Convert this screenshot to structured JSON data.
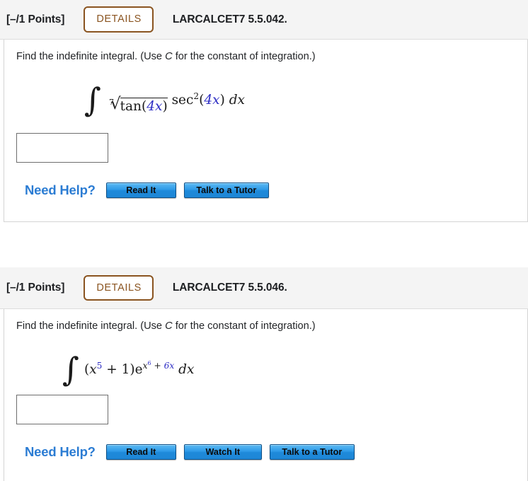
{
  "problems": [
    {
      "points_label": "[–/1 Points]",
      "details_label": "DETAILS",
      "assignment_id": "LARCALCET7 5.5.042.",
      "prompt_before": "Find the indefinite integral. (Use ",
      "prompt_var": "C",
      "prompt_after": " for the constant of integration.)",
      "math_plain": "∫ 7√(tan(4x)) sec^2(4x) dx",
      "math": {
        "integral_sign": "∫",
        "radical_index": "7",
        "radical_sign": "√",
        "fn1": "tan(",
        "arg1": "4x",
        "fn1_close": ")",
        "fn2": "sec",
        "fn2_exp": "2",
        "fn2_open": "(",
        "arg2": "4x",
        "fn2_close": ")",
        "differential": "dx"
      },
      "answer_value": "",
      "need_help_label": "Need Help?",
      "help_buttons": [
        "Read It",
        "Talk to a Tutor"
      ]
    },
    {
      "points_label": "[–/1 Points]",
      "details_label": "DETAILS",
      "assignment_id": "LARCALCET7 5.5.046.",
      "prompt_before": "Find the indefinite integral. (Use ",
      "prompt_var": "C",
      "prompt_after": " for the constant of integration.)",
      "math_plain": "∫ (x^5 + 1)e^(x^6 + 6x) dx",
      "math": {
        "integral_sign": "∫",
        "open_paren": "(",
        "base_var": "x",
        "base_exp": "5",
        "plus_one": " + 1)",
        "e_sym": "e",
        "exp_var": "x",
        "exp_exp": "6",
        "exp_plus": " + ",
        "exp_term": "6x",
        "differential": "dx"
      },
      "answer_value": "",
      "need_help_label": "Need Help?",
      "help_buttons": [
        "Read It",
        "Watch It",
        "Talk to a Tutor"
      ]
    }
  ],
  "colors": {
    "header_bg": "#f4f4f4",
    "details_brown": "#8a5420",
    "need_help_blue": "#2b7cd3",
    "button_blue": "#1f8ada",
    "math_blue": "#2f2fc4",
    "text_dark": "#1d1f22"
  }
}
